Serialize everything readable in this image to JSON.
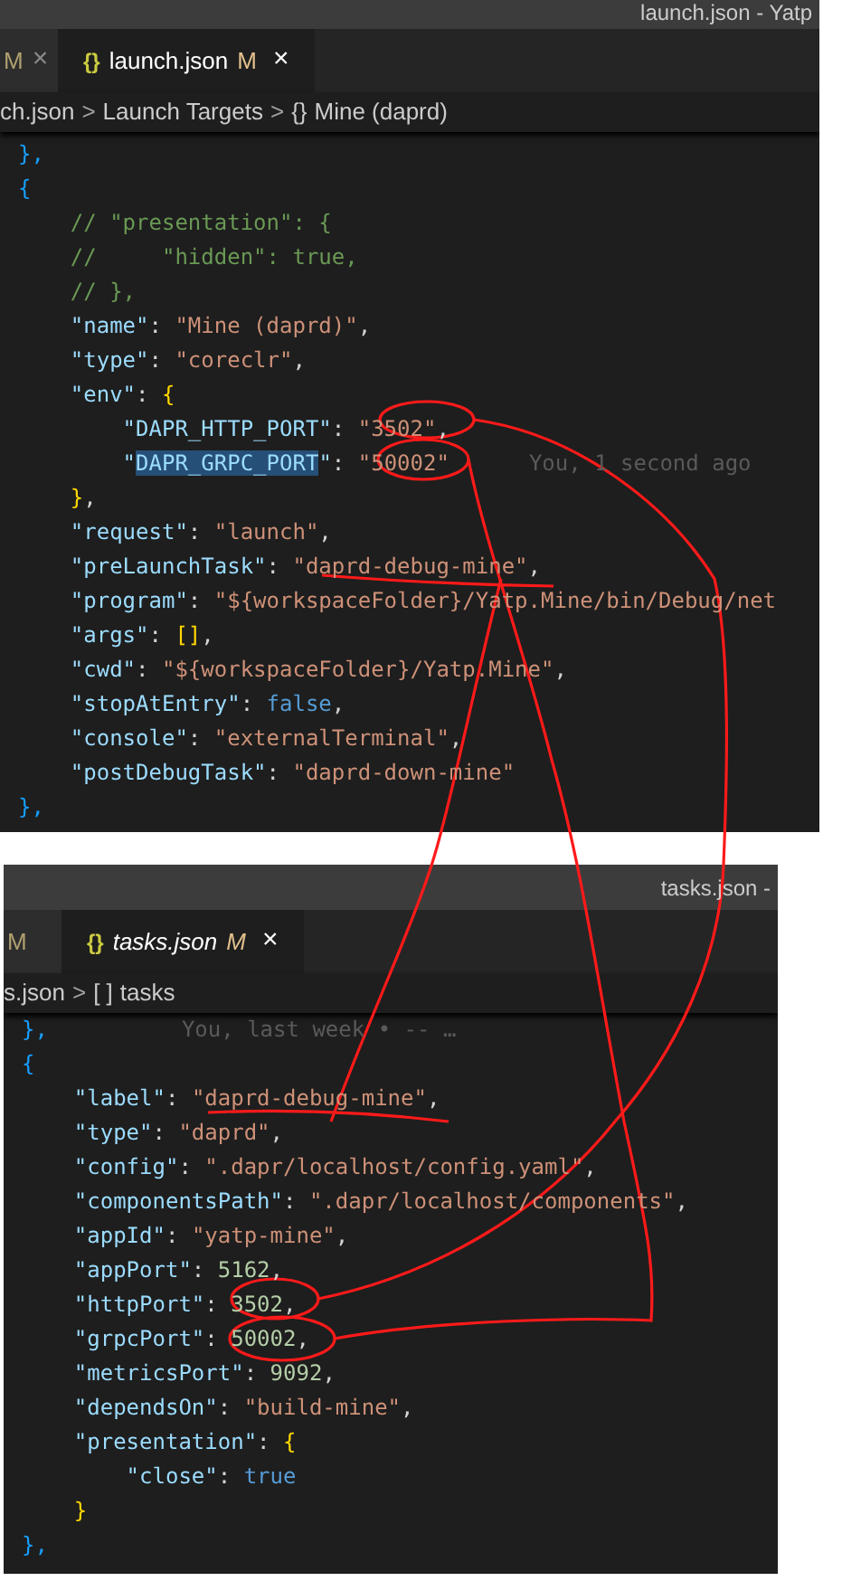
{
  "editors": [
    {
      "title": "launch.json - Yatp",
      "tabs": [
        {
          "label": "M",
          "close": "×",
          "selected": false
        },
        {
          "icon": "{}",
          "label": "launch.json",
          "status": "M",
          "close": "×",
          "selected": true,
          "italic": false
        }
      ],
      "breadcrumb": [
        {
          "kind": "text",
          "text": "ch.json"
        },
        {
          "kind": "sep",
          "text": ">"
        },
        {
          "kind": "text",
          "text": "Launch Targets"
        },
        {
          "kind": "sep",
          "text": ">"
        },
        {
          "kind": "icon",
          "text": "{}"
        },
        {
          "kind": "text",
          "text": "Mine (daprd)"
        }
      ],
      "lines": [
        {
          "tokens": [
            {
              "kind": "brace",
              "text": "},"
            }
          ]
        },
        {
          "tokens": [
            {
              "kind": "brace",
              "text": "{"
            }
          ]
        },
        {
          "tokens": [
            {
              "kind": "comment",
              "text": "    // \"presentation\": {"
            }
          ]
        },
        {
          "tokens": [
            {
              "kind": "comment",
              "text": "    //     \"hidden\": true,"
            }
          ]
        },
        {
          "tokens": [
            {
              "kind": "comment",
              "text": "    // },"
            }
          ]
        },
        {
          "tokens": [
            {
              "kind": "key",
              "text": "    \"name\""
            },
            {
              "kind": "punct",
              "text": ": "
            },
            {
              "kind": "str",
              "text": "\"Mine (daprd)\""
            },
            {
              "kind": "punct",
              "text": ","
            }
          ]
        },
        {
          "tokens": [
            {
              "kind": "key",
              "text": "    \"type\""
            },
            {
              "kind": "punct",
              "text": ": "
            },
            {
              "kind": "str",
              "text": "\"coreclr\""
            },
            {
              "kind": "punct",
              "text": ","
            }
          ]
        },
        {
          "tokens": [
            {
              "kind": "key",
              "text": "    \"env\""
            },
            {
              "kind": "punct",
              "text": ": "
            },
            {
              "kind": "brace2",
              "text": "{"
            }
          ]
        },
        {
          "tokens": [
            {
              "kind": "key",
              "text": "        \"DAPR_HTTP_PORT\""
            },
            {
              "kind": "punct",
              "text": ": "
            },
            {
              "kind": "str",
              "text": "\"3502\""
            },
            {
              "kind": "punct",
              "text": ","
            }
          ]
        },
        {
          "tokens": [
            {
              "kind": "key",
              "text": "        \""
            },
            {
              "kind": "sel",
              "text": "DAPR_GRPC_PORT"
            },
            {
              "kind": "key",
              "text": "\""
            },
            {
              "kind": "punct",
              "text": ": "
            },
            {
              "kind": "str",
              "text": "\"50002\""
            }
          ],
          "blame": "You, 1 second ago"
        },
        {
          "tokens": [
            {
              "kind": "brace2",
              "text": "    }"
            },
            {
              "kind": "punct",
              "text": ","
            }
          ]
        },
        {
          "tokens": [
            {
              "kind": "key",
              "text": "    \"request\""
            },
            {
              "kind": "punct",
              "text": ": "
            },
            {
              "kind": "str",
              "text": "\"launch\""
            },
            {
              "kind": "punct",
              "text": ","
            }
          ]
        },
        {
          "tokens": [
            {
              "kind": "key",
              "text": "    \"preLaunchTask\""
            },
            {
              "kind": "punct",
              "text": ": "
            },
            {
              "kind": "str",
              "text": "\"daprd-debug-mine\""
            },
            {
              "kind": "punct",
              "text": ","
            }
          ]
        },
        {
          "tokens": [
            {
              "kind": "key",
              "text": "    \"program\""
            },
            {
              "kind": "punct",
              "text": ": "
            },
            {
              "kind": "str",
              "text": "\"${workspaceFolder}/Yatp.Mine/bin/Debug/net"
            }
          ]
        },
        {
          "tokens": [
            {
              "kind": "key",
              "text": "    \"args\""
            },
            {
              "kind": "punct",
              "text": ": "
            },
            {
              "kind": "brace2",
              "text": "[]"
            },
            {
              "kind": "punct",
              "text": ","
            }
          ]
        },
        {
          "tokens": [
            {
              "kind": "key",
              "text": "    \"cwd\""
            },
            {
              "kind": "punct",
              "text": ": "
            },
            {
              "kind": "str",
              "text": "\"${workspaceFolder}/Yatp.Mine\""
            },
            {
              "kind": "punct",
              "text": ","
            }
          ]
        },
        {
          "tokens": [
            {
              "kind": "key",
              "text": "    \"stopAtEntry\""
            },
            {
              "kind": "punct",
              "text": ": "
            },
            {
              "kind": "bool",
              "text": "false"
            },
            {
              "kind": "punct",
              "text": ","
            }
          ]
        },
        {
          "tokens": [
            {
              "kind": "key",
              "text": "    \"console\""
            },
            {
              "kind": "punct",
              "text": ": "
            },
            {
              "kind": "str",
              "text": "\"externalTerminal\""
            },
            {
              "kind": "punct",
              "text": ","
            }
          ]
        },
        {
          "tokens": [
            {
              "kind": "key",
              "text": "    \"postDebugTask\""
            },
            {
              "kind": "punct",
              "text": ": "
            },
            {
              "kind": "str",
              "text": "\"daprd-down-mine\""
            }
          ]
        },
        {
          "tokens": [
            {
              "kind": "brace",
              "text": "},"
            }
          ]
        }
      ]
    },
    {
      "title": "tasks.json -",
      "tabs": [
        {
          "label": "M",
          "selected": false
        },
        {
          "icon": "{}",
          "label": "tasks.json",
          "status": "M",
          "close": "×",
          "selected": true,
          "italic": true
        }
      ],
      "breadcrumb": [
        {
          "kind": "text",
          "text": "s.json"
        },
        {
          "kind": "sep",
          "text": ">"
        },
        {
          "kind": "icon",
          "text": "[ ]"
        },
        {
          "kind": "text",
          "text": "tasks"
        }
      ],
      "lines": [
        {
          "tokens": [
            {
              "kind": "brace",
              "text": "},"
            }
          ],
          "blame": "You, last week • -- …"
        },
        {
          "tokens": [
            {
              "kind": "brace",
              "text": "{"
            }
          ]
        },
        {
          "tokens": [
            {
              "kind": "key",
              "text": "    \"label\""
            },
            {
              "kind": "punct",
              "text": ": "
            },
            {
              "kind": "str",
              "text": "\"daprd-debug-mine\""
            },
            {
              "kind": "punct",
              "text": ","
            }
          ]
        },
        {
          "tokens": [
            {
              "kind": "key",
              "text": "    \"type\""
            },
            {
              "kind": "punct",
              "text": ": "
            },
            {
              "kind": "str",
              "text": "\"daprd\""
            },
            {
              "kind": "punct",
              "text": ","
            }
          ]
        },
        {
          "tokens": [
            {
              "kind": "key",
              "text": "    \"config\""
            },
            {
              "kind": "punct",
              "text": ": "
            },
            {
              "kind": "str",
              "text": "\".dapr/localhost/config.yaml\""
            },
            {
              "kind": "punct",
              "text": ","
            }
          ]
        },
        {
          "tokens": [
            {
              "kind": "key",
              "text": "    \"componentsPath\""
            },
            {
              "kind": "punct",
              "text": ": "
            },
            {
              "kind": "str",
              "text": "\".dapr/localhost/components\""
            },
            {
              "kind": "punct",
              "text": ","
            }
          ]
        },
        {
          "tokens": [
            {
              "kind": "key",
              "text": "    \"appId\""
            },
            {
              "kind": "punct",
              "text": ": "
            },
            {
              "kind": "str",
              "text": "\"yatp-mine\""
            },
            {
              "kind": "punct",
              "text": ","
            }
          ]
        },
        {
          "tokens": [
            {
              "kind": "key",
              "text": "    \"appPort\""
            },
            {
              "kind": "punct",
              "text": ": "
            },
            {
              "kind": "num",
              "text": "5162"
            },
            {
              "kind": "punct",
              "text": ","
            }
          ]
        },
        {
          "tokens": [
            {
              "kind": "key",
              "text": "    \"httpPort\""
            },
            {
              "kind": "punct",
              "text": ": "
            },
            {
              "kind": "num",
              "text": "3502"
            },
            {
              "kind": "punct",
              "text": ","
            }
          ]
        },
        {
          "tokens": [
            {
              "kind": "key",
              "text": "    \"grpcPort\""
            },
            {
              "kind": "punct",
              "text": ": "
            },
            {
              "kind": "num",
              "text": "50002"
            },
            {
              "kind": "punct",
              "text": ","
            }
          ]
        },
        {
          "tokens": [
            {
              "kind": "key",
              "text": "    \"metricsPort\""
            },
            {
              "kind": "punct",
              "text": ": "
            },
            {
              "kind": "num",
              "text": "9092"
            },
            {
              "kind": "punct",
              "text": ","
            }
          ]
        },
        {
          "tokens": [
            {
              "kind": "key",
              "text": "    \"dependsOn\""
            },
            {
              "kind": "punct",
              "text": ": "
            },
            {
              "kind": "str",
              "text": "\"build-mine\""
            },
            {
              "kind": "punct",
              "text": ","
            }
          ]
        },
        {
          "tokens": [
            {
              "kind": "key",
              "text": "    \"presentation\""
            },
            {
              "kind": "punct",
              "text": ": "
            },
            {
              "kind": "brace2",
              "text": "{"
            }
          ]
        },
        {
          "tokens": [
            {
              "kind": "key",
              "text": "        \"close\""
            },
            {
              "kind": "punct",
              "text": ": "
            },
            {
              "kind": "bool",
              "text": "true"
            }
          ]
        },
        {
          "tokens": [
            {
              "kind": "brace2",
              "text": "    }"
            }
          ]
        },
        {
          "tokens": [
            {
              "kind": "brace",
              "text": "},"
            }
          ]
        }
      ]
    }
  ]
}
